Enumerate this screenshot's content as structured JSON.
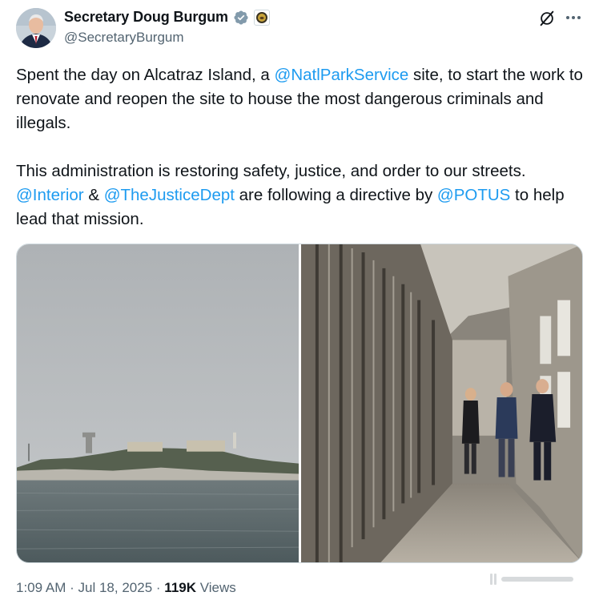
{
  "author": {
    "display_name": "Secretary Doug Burgum",
    "handle": "@SecretaryBurgum",
    "avatar_icon": "profile-photo",
    "verified_icon": "gray-verified-badge-icon",
    "affiliation_icon": "department-seal-icon"
  },
  "header_actions": {
    "grok_icon": "grok-icon",
    "more_icon": "more-options-icon"
  },
  "tweet": {
    "p1_a": "Spent the day on Alcatraz Island, a ",
    "p1_mention": "@NatlParkService",
    "p1_b": " site, to start the work to renovate and reopen the site to house the most dangerous criminals and illegals.",
    "p2_a": "This administration is restoring safety, justice, and order to our streets. ",
    "p2_m1": "@Interior",
    "p2_b": " & ",
    "p2_m2": "@TheJusticeDept",
    "p2_c": " are following a directive by ",
    "p2_m3": "@POTUS",
    "p2_d": " to help lead that mission."
  },
  "media": {
    "photos": [
      {
        "description_icon": "alcatraz-island-photo"
      },
      {
        "description_icon": "cell-block-corridor-photo"
      }
    ]
  },
  "meta": {
    "time": "1:09 AM",
    "separator": "·",
    "date": "Jul 18, 2025",
    "views_count": "119K",
    "views_label": "Views"
  },
  "colors": {
    "link": "#1d9bf0",
    "text": "#0f1419",
    "secondary": "#536471",
    "border": "#cfd9de"
  }
}
